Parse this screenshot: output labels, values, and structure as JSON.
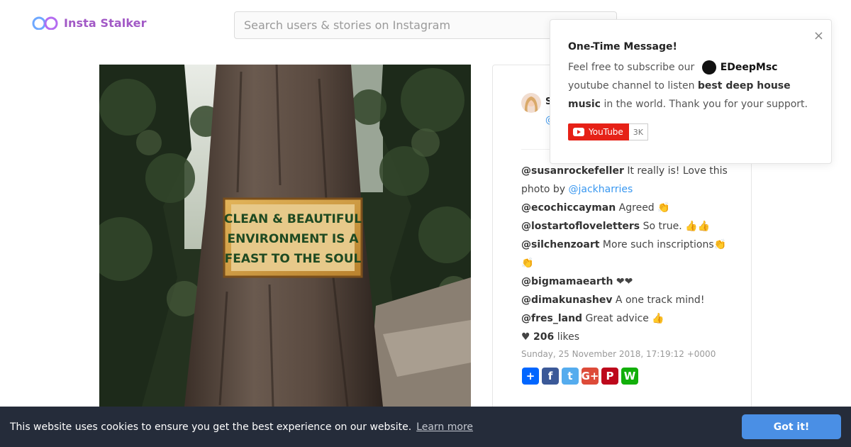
{
  "header": {
    "logo_text": "Insta Stalker",
    "search_placeholder": "Search users & stories on Instagram"
  },
  "post": {
    "owner_initial": "S",
    "owner_handle": "@",
    "sign_text": [
      "CLEAN & BEAUTIFUL",
      "ENVIRONMENT IS A",
      "FEAST TO THE SOUL"
    ],
    "comments": [
      {
        "user": "@susanrockefeller",
        "text": "It really is! Love this photo by",
        "mention": "@jackharries"
      },
      {
        "user": "@ecochiccayman",
        "text": "Agreed 👏"
      },
      {
        "user": "@lostartofloveletters",
        "text": "So true. 👍👍"
      },
      {
        "user": "@silchenzoart",
        "text": "More such inscriptions👏👏"
      },
      {
        "user": "@bigmamaearth",
        "text": "❤❤"
      },
      {
        "user": "@dimakunashev",
        "text": "A one track mind!"
      },
      {
        "user": "@fres_land",
        "text": "Great advice 👍"
      }
    ],
    "likes_icon": "heart-icon",
    "likes_count": "206",
    "likes_label": "likes",
    "date": "Sunday, 25 November 2018, 17:19:12 +0000",
    "share_buttons": [
      {
        "name": "share-add-button",
        "glyph": "+",
        "color": "#0166ff"
      },
      {
        "name": "share-facebook-button",
        "glyph": "f",
        "color": "#3b5998"
      },
      {
        "name": "share-twitter-button",
        "glyph": "t",
        "color": "#55acee"
      },
      {
        "name": "share-googleplus-button",
        "glyph": "G+",
        "color": "#dd4b39"
      },
      {
        "name": "share-pinterest-button",
        "glyph": "P",
        "color": "#bd081c"
      },
      {
        "name": "share-whatsapp-button",
        "glyph": "W",
        "color": "#12af0a"
      }
    ]
  },
  "popup": {
    "title": "One-Time Message!",
    "body_before": "Feel free to subscribe our",
    "channel_name": "EDeepMsc",
    "body_after": "youtube channel to listen",
    "body_bold": "best deep house music",
    "body_end": "in the world. Thank you for your support.",
    "close_glyph": "×",
    "youtube_label": "YouTube",
    "youtube_count": "3K"
  },
  "cookie": {
    "message": "This website uses cookies to ensure you get the best experience on our website.",
    "learn_more": "Learn more",
    "button": "Got it!"
  },
  "colors": {
    "brand": "#a259c6",
    "link": "#3897f0",
    "cookie_bg": "#252c3a",
    "cookie_button": "#4a8fe5",
    "youtube_red": "#e62117"
  }
}
